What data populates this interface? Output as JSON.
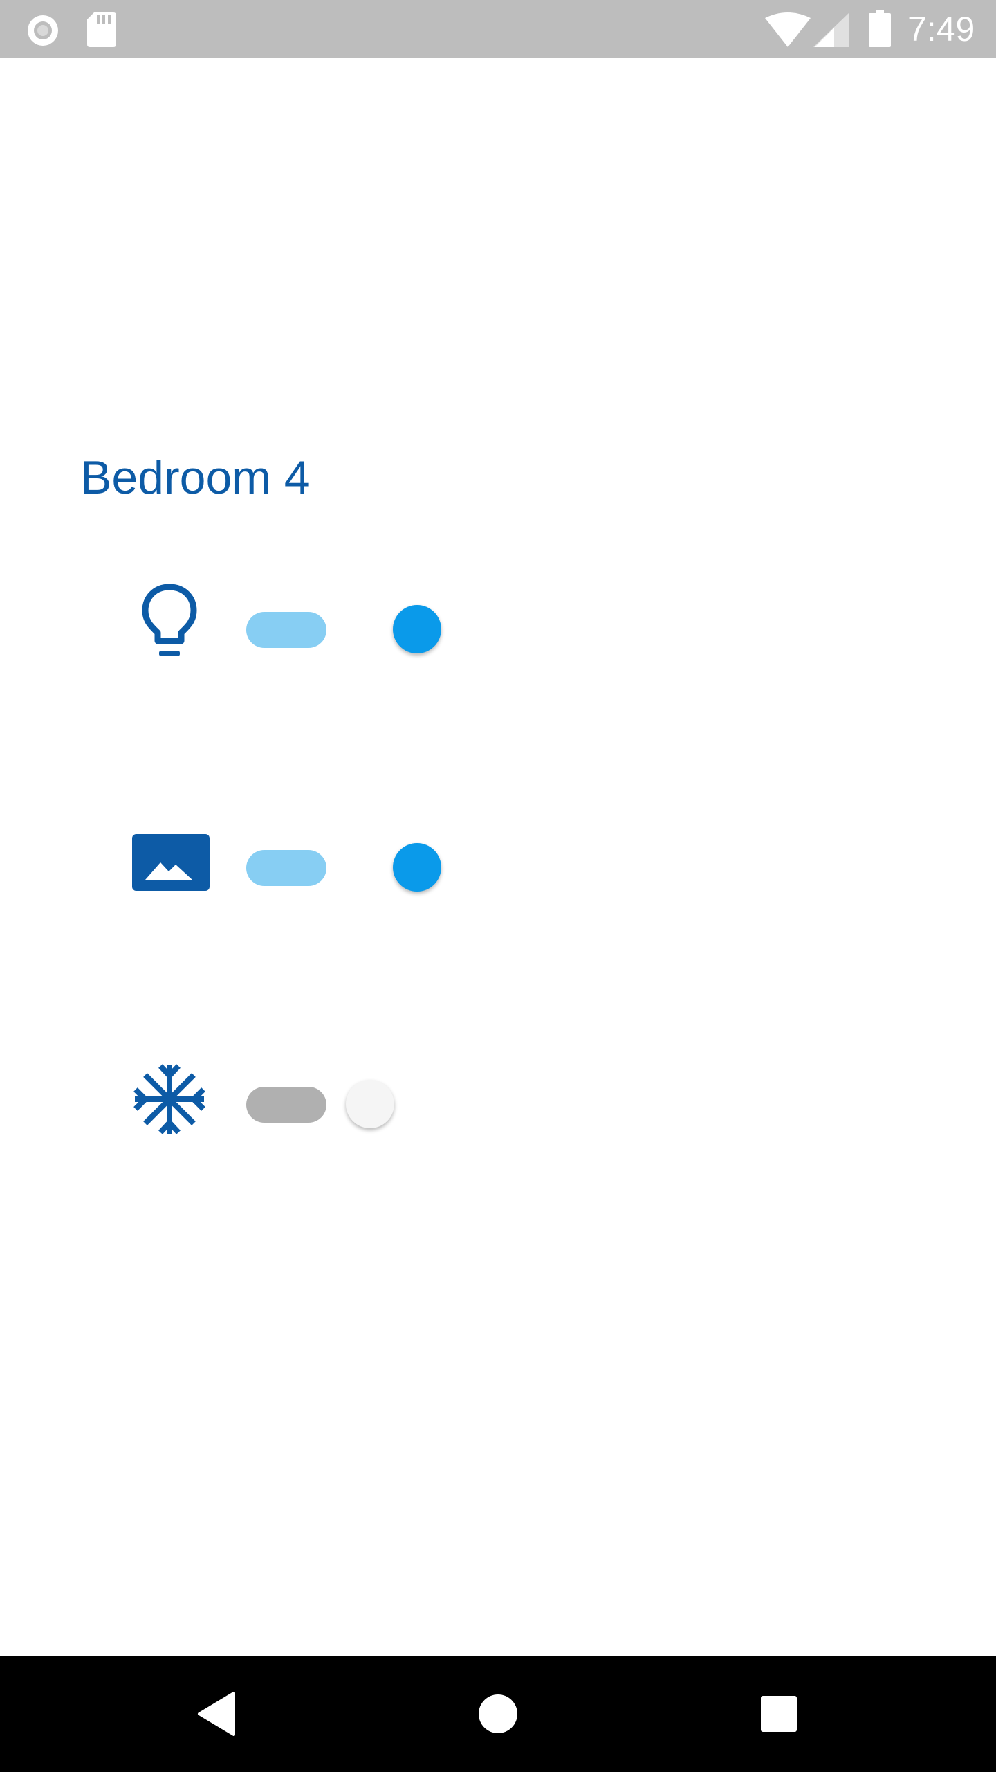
{
  "status_bar": {
    "time": "7:49",
    "icons": [
      "record-icon",
      "sd-card-icon",
      "wifi-icon",
      "signal-icon",
      "battery-icon"
    ]
  },
  "room": {
    "title": "Bedroom 4"
  },
  "devices": [
    {
      "icon": "lightbulb-icon",
      "switch_on": true
    },
    {
      "icon": "picture-frame-icon",
      "switch_on": true
    },
    {
      "icon": "snowflake-icon",
      "switch_on": false
    }
  ],
  "nav_bar": {
    "icons": [
      "back-icon",
      "home-icon",
      "recents-icon"
    ]
  },
  "colors": {
    "accent": "#0d5ba6",
    "switch_on_thumb": "#0a9aea",
    "switch_on_track": "#87cef3",
    "switch_off_thumb": "#f5f5f5",
    "switch_off_track": "#b0b0b0",
    "status_bar": "#bdbdbd",
    "nav_bar": "#000000"
  }
}
